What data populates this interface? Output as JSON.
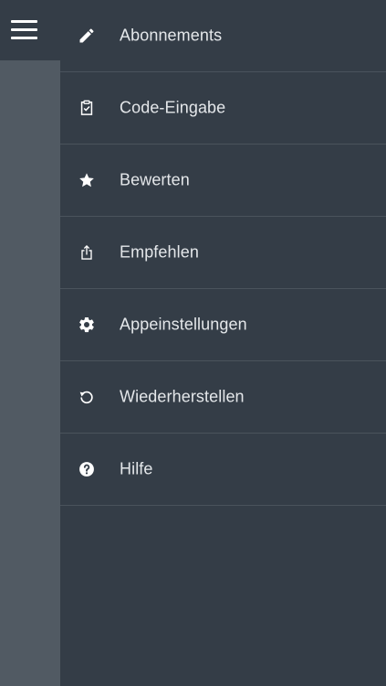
{
  "nav": {
    "menu_icon": "hamburger-menu-icon"
  },
  "menu": {
    "items": [
      {
        "label": "Abonnements",
        "icon": "pencil-icon"
      },
      {
        "label": "Code-Eingabe",
        "icon": "clipboard-check-icon"
      },
      {
        "label": "Bewerten",
        "icon": "star-icon"
      },
      {
        "label": "Empfehlen",
        "icon": "share-icon"
      },
      {
        "label": "Appeinstellungen",
        "icon": "gear-icon"
      },
      {
        "label": "Wiederherstellen",
        "icon": "restore-icon"
      },
      {
        "label": "Hilfe",
        "icon": "help-icon"
      }
    ]
  },
  "colors": {
    "drawer_background": "#343d47",
    "rail_background": "#515a63",
    "divider": "#4a535c",
    "text": "#e4e7ea",
    "icon": "#ffffff"
  }
}
